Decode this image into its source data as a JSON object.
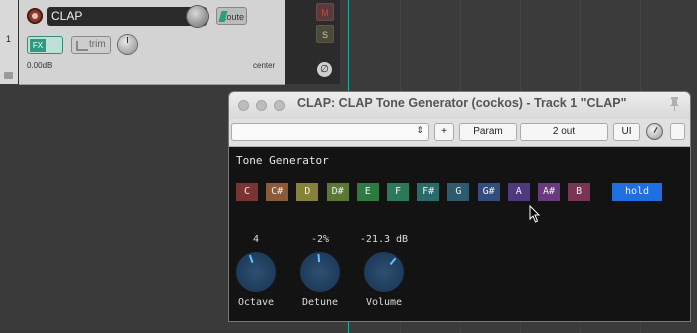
{
  "track": {
    "number": "1",
    "name": "CLAP",
    "route_label": "Route",
    "fx_label": "FX",
    "trim_label": "trim",
    "volume_readout": "0.00dB",
    "pan_readout": "center",
    "mute_label": "M",
    "solo_label": "S",
    "phase_label": "∅"
  },
  "window": {
    "title": "CLAP: CLAP Tone Generator (cockos) - Track 1 \"CLAP\"",
    "toolbar": {
      "preset_value": "",
      "plus_label": "+",
      "param_label": "Param",
      "out_label": "2 out",
      "ui_label": "UI"
    }
  },
  "plugin": {
    "heading": "Tone Generator",
    "notes": [
      {
        "label": "C",
        "color": "#7a3434"
      },
      {
        "label": "C#",
        "color": "#8a5a3a"
      },
      {
        "label": "D",
        "color": "#86823a"
      },
      {
        "label": "D#",
        "color": "#5a7a34"
      },
      {
        "label": "E",
        "color": "#2f7a3f"
      },
      {
        "label": "F",
        "color": "#2a7a5a"
      },
      {
        "label": "F#",
        "color": "#2a6a6a"
      },
      {
        "label": "G",
        "color": "#2e5a6e"
      },
      {
        "label": "G#",
        "color": "#344b7e"
      },
      {
        "label": "A",
        "color": "#4d3a7e"
      },
      {
        "label": "A#",
        "color": "#6a3a7e"
      },
      {
        "label": "B",
        "color": "#7a3454"
      }
    ],
    "hold_label": "hold",
    "params": [
      {
        "name": "Octave",
        "value": "4"
      },
      {
        "name": "Detune",
        "value": "-2%"
      },
      {
        "name": "Volume",
        "value": "-21.3 dB"
      }
    ]
  },
  "colors": {
    "accent": "#1f6fe0",
    "play_cursor": "#2aa69a",
    "dial_indicator": "#5cc6ff"
  }
}
